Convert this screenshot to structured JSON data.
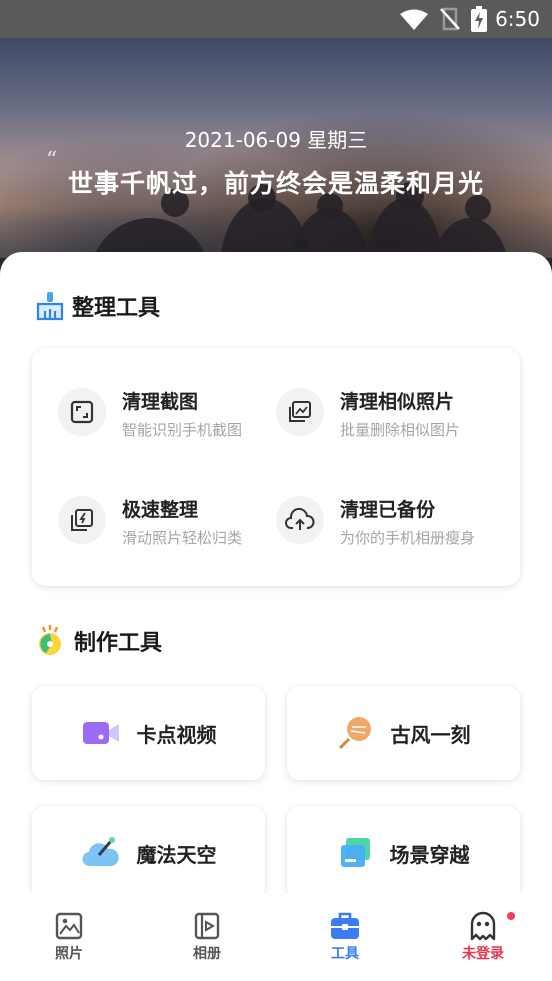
{
  "status_bar": {
    "time": "6:50"
  },
  "hero": {
    "date": "2021-06-09 星期三",
    "quote_mark": "“",
    "quote": "世事千帆过，前方终会是温柔和月光"
  },
  "organize": {
    "title": "整理工具",
    "tools": [
      {
        "name": "清理截图",
        "desc": "智能识别手机截图",
        "icon": "screenshot-icon"
      },
      {
        "name": "清理相似照片",
        "desc": "批量删除相似图片",
        "icon": "similar-photos-icon"
      },
      {
        "name": "极速整理",
        "desc": "滑动照片轻松归类",
        "icon": "fast-sort-icon"
      },
      {
        "name": "清理已备份",
        "desc": "为你的手机相册瘦身",
        "icon": "cloud-upload-icon"
      }
    ]
  },
  "create": {
    "title": "制作工具",
    "tools": [
      {
        "name": "卡点视频",
        "icon": "video-camera-icon"
      },
      {
        "name": "古风一刻",
        "icon": "fan-icon"
      },
      {
        "name": "魔法天空",
        "icon": "magic-sky-icon"
      },
      {
        "name": "场景穿越",
        "icon": "scene-icon"
      }
    ]
  },
  "bottom_nav": {
    "items": [
      {
        "label": "照片",
        "icon": "photo-icon",
        "active": false
      },
      {
        "label": "相册",
        "icon": "album-icon",
        "active": false
      },
      {
        "label": "工具",
        "icon": "toolbox-icon",
        "active": true
      },
      {
        "label": "未登录",
        "icon": "ghost-icon",
        "active": false
      }
    ]
  },
  "colors": {
    "accent": "#3a7bf6",
    "login_red": "#e8344e",
    "nav_gray": "#555555"
  }
}
